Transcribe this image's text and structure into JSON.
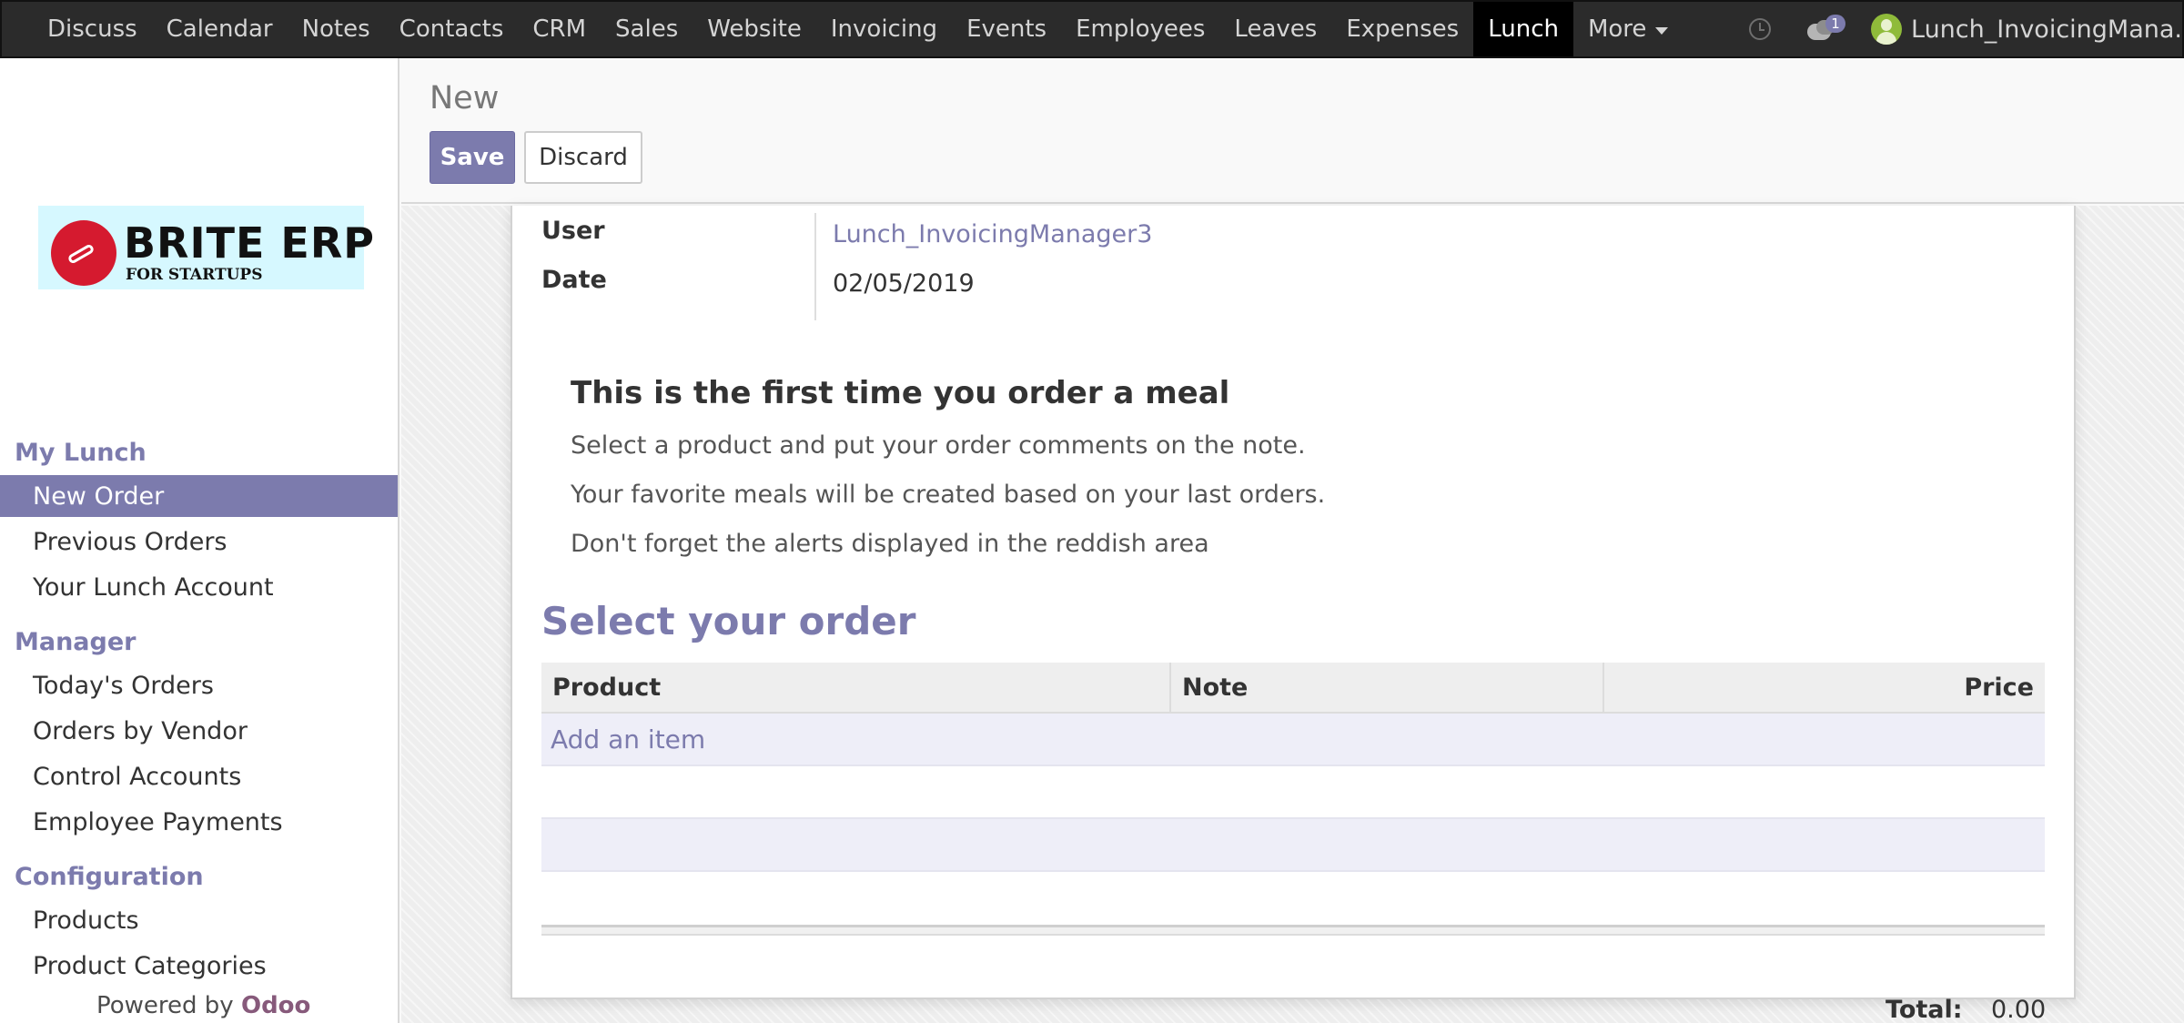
{
  "navbar": {
    "menu": [
      "Discuss",
      "Calendar",
      "Notes",
      "Contacts",
      "CRM",
      "Sales",
      "Website",
      "Invoicing",
      "Events",
      "Employees",
      "Leaves",
      "Expenses",
      "Lunch"
    ],
    "active": "Lunch",
    "more_label": "More",
    "messages_badge": "1",
    "user_name": "Lunch_InvoicingMana..."
  },
  "sidebar": {
    "logo_title": "BRITE ERP",
    "logo_subtitle": "FOR STARTUPS",
    "sections": [
      {
        "title": "My Lunch",
        "items": [
          "New Order",
          "Previous Orders",
          "Your Lunch Account"
        ]
      },
      {
        "title": "Manager",
        "items": [
          "Today's Orders",
          "Orders by Vendor",
          "Control Accounts",
          "Employee Payments"
        ]
      },
      {
        "title": "Configuration",
        "items": [
          "Products",
          "Product Categories"
        ]
      }
    ],
    "active_item": "New Order",
    "powered_by": "Powered by",
    "powered_brand": "Odoo"
  },
  "control_panel": {
    "breadcrumb": "New",
    "save_label": "Save",
    "discard_label": "Discard"
  },
  "form": {
    "user_label": "User",
    "user_value": "Lunch_InvoicingManager3",
    "date_label": "Date",
    "date_value": "02/05/2019",
    "help_title": "This is the first time you order a meal",
    "help_lines": [
      "Select a product and put your order comments on the note.",
      "Your favorite meals will be created based on your last orders.",
      "Don't forget the alerts displayed in the reddish area"
    ],
    "order_heading": "Select your order",
    "columns": [
      "Product",
      "Note",
      "Price"
    ],
    "add_item_label": "Add an item",
    "total_label": "Total:",
    "total_value": "0.00"
  },
  "colors": {
    "accent": "#7c7bad",
    "navbar": "#2b2b2b",
    "logo_red": "#d51a2f"
  }
}
